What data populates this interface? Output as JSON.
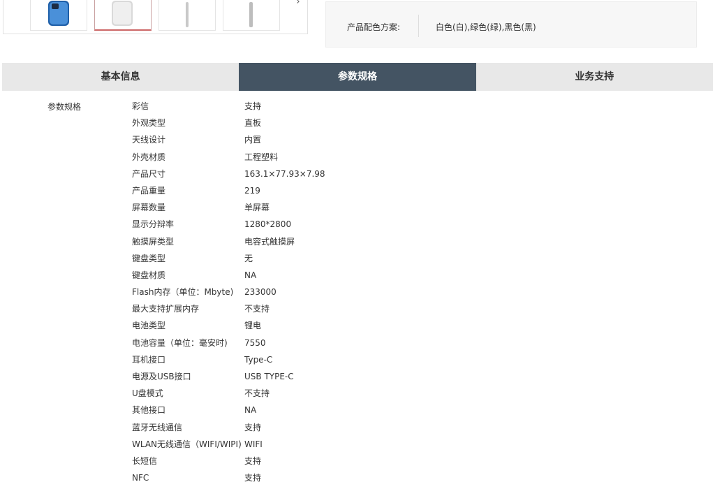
{
  "gallery": {
    "next_icon": "›"
  },
  "color_scheme": {
    "label": "产品配色方案:",
    "value": "白色(白),绿色(绿),黑色(黑)"
  },
  "tabs": [
    {
      "label": "基本信息",
      "active": false
    },
    {
      "label": "参数规格",
      "active": true
    },
    {
      "label": "业务支持",
      "active": false
    }
  ],
  "specs": {
    "section_title": "参数规格",
    "rows": [
      {
        "key": "彩信",
        "value": "支持"
      },
      {
        "key": "外观类型",
        "value": "直板"
      },
      {
        "key": "天线设计",
        "value": "内置"
      },
      {
        "key": "外壳材质",
        "value": "工程塑料"
      },
      {
        "key": "产品尺寸",
        "value": "163.1×77.93×7.98"
      },
      {
        "key": "产品重量",
        "value": "219"
      },
      {
        "key": "屏幕数量",
        "value": "单屏幕"
      },
      {
        "key": "显示分辩率",
        "value": "1280*2800"
      },
      {
        "key": "触摸屏类型",
        "value": "电容式触摸屏"
      },
      {
        "key": "键盘类型",
        "value": "无"
      },
      {
        "key": "键盘材质",
        "value": "NA"
      },
      {
        "key": "Flash内存（单位：Mbyte)",
        "value": "233000"
      },
      {
        "key": "最大支持扩展内存",
        "value": "不支持"
      },
      {
        "key": "电池类型",
        "value": "锂电"
      },
      {
        "key": "电池容量（单位：毫安时)",
        "value": "7550"
      },
      {
        "key": "耳机接口",
        "value": "Type-C"
      },
      {
        "key": "电源及USB接口",
        "value": "USB TYPE-C"
      },
      {
        "key": "U盘模式",
        "value": "不支持"
      },
      {
        "key": "其他接口",
        "value": "NA"
      },
      {
        "key": "蓝牙无线通信",
        "value": "支持"
      },
      {
        "key": "WLAN无线通信（WIFI/WIPI)",
        "value": "WIFI"
      },
      {
        "key": "长短信",
        "value": "支持"
      },
      {
        "key": "NFC",
        "value": "支持"
      }
    ]
  },
  "colors": {
    "active_tab_bg": "#445463",
    "tab_bg": "#e8e8e8"
  }
}
